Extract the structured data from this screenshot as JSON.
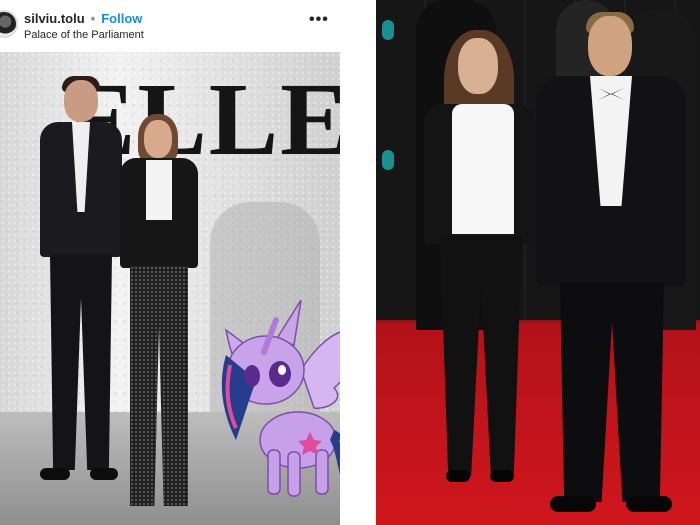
{
  "post": {
    "username": "silviu.tolu",
    "separator": "•",
    "follow_label": "Follow",
    "location": "Palace of the Parliament",
    "more_label": "•••"
  },
  "photo": {
    "backdrop_text": "ELLE"
  },
  "icons": {
    "avatar": "avatar",
    "more": "more-options-icon"
  },
  "colors": {
    "follow_blue": "#1b8be0",
    "carpet_red": "#d0161d",
    "pony_purple": "#b48ed6"
  }
}
